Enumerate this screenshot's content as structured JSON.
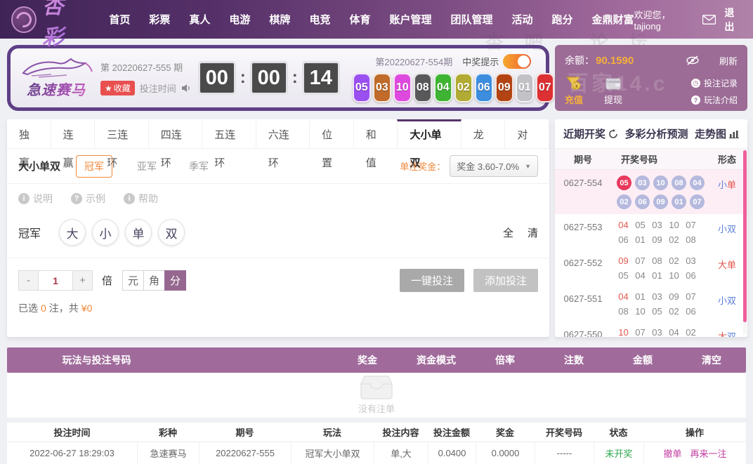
{
  "navbar": {
    "brand": "杏彩",
    "items": [
      "首页",
      "彩票",
      "真人",
      "电游",
      "棋牌",
      "电竞",
      "体育",
      "账户管理",
      "团队管理",
      "活动",
      "跑分",
      "金鼎财富"
    ],
    "welcome": "欢迎您，tajiong",
    "logout": "退出"
  },
  "watermarks": {
    "nav": "杏吧 论坛",
    "wallet": "百家14.c"
  },
  "banner": {
    "game_name": "急速赛马",
    "issue_label": "第 20220627-555 期",
    "favorite_label": "收藏",
    "bet_time_label": "投注时间",
    "countdown": {
      "h": "00",
      "m": "00",
      "s": "14"
    },
    "last_issue_label": "第20220627-554期",
    "win_tip_label": "中奖提示",
    "result_numbers": [
      {
        "num": "05",
        "color": "#9a4ff0"
      },
      {
        "num": "03",
        "color": "#c06b2a"
      },
      {
        "num": "10",
        "color": "#de4ade"
      },
      {
        "num": "08",
        "color": "#58585a"
      },
      {
        "num": "04",
        "color": "#3fb332"
      },
      {
        "num": "02",
        "color": "#b2ab33"
      },
      {
        "num": "06",
        "color": "#3d8ddf"
      },
      {
        "num": "09",
        "color": "#b24413"
      },
      {
        "num": "01",
        "color": "#c2c2c6"
      },
      {
        "num": "07",
        "color": "#dc3032"
      }
    ]
  },
  "wallet": {
    "balance_label": "余额：",
    "balance_value": "90.1590",
    "refresh_label": "刷新",
    "recharge_label": "充值",
    "withdraw_label": "提现",
    "record_label": "投注记录",
    "intro_label": "玩法介绍"
  },
  "tabs": {
    "items": [
      "独赢",
      "连赢",
      "三连环",
      "四连环",
      "五连环",
      "六连环",
      "位置",
      "和值",
      "大小单双",
      "龙虎",
      "对决"
    ],
    "active_index": 8
  },
  "bet": {
    "group_title": "大小单双",
    "positions": [
      "冠军",
      "亚军",
      "季军"
    ],
    "active_position": 0,
    "prize_label": "单注奖金：",
    "prize_value": "奖金 3.60-7.0%",
    "helpers": [
      {
        "icon": "i",
        "label": "说明"
      },
      {
        "icon": "?",
        "label": "示例"
      },
      {
        "icon": "i",
        "label": "帮助"
      }
    ],
    "row_label": "冠军",
    "options": [
      "大",
      "小",
      "单",
      "双"
    ],
    "select_all_label": "全",
    "clear_label": "清",
    "stepper": {
      "minus": "-",
      "value": "1",
      "plus": "+",
      "unit_label": "倍"
    },
    "units": [
      "元",
      "角",
      "分"
    ],
    "active_unit": 2,
    "selected_prefix": "已选",
    "selected_count": "0",
    "selected_infix": "注，共",
    "selected_amount": "¥0",
    "quick_bet_label": "一键投注",
    "add_bet_label": "添加投注"
  },
  "history": {
    "title": "近期开奖",
    "analysis_label": "多彩分析预测",
    "trend_label": "走势图",
    "columns": [
      "期号",
      "开奖号码",
      "形态"
    ],
    "rows": [
      {
        "issue": "0627-554",
        "style": "balls",
        "highlight": true,
        "line1": [
          "05",
          "03",
          "10",
          "08",
          "04"
        ],
        "line2": [
          "02",
          "06",
          "09",
          "01",
          "07"
        ],
        "pattern": [
          {
            "text": "小",
            "color": "#5b7fd9"
          },
          {
            "text": "单",
            "color": "#e2574c"
          }
        ]
      },
      {
        "issue": "0627-553",
        "style": "text",
        "highlight": false,
        "line1": [
          "04",
          "05",
          "03",
          "10",
          "07"
        ],
        "line2": [
          "06",
          "01",
          "09",
          "02",
          "08"
        ],
        "pattern": [
          {
            "text": "小",
            "color": "#5b7fd9"
          },
          {
            "text": "双",
            "color": "#5b7fd9"
          }
        ]
      },
      {
        "issue": "0627-552",
        "style": "text",
        "highlight": false,
        "line1": [
          "09",
          "07",
          "08",
          "02",
          "03"
        ],
        "line2": [
          "05",
          "04",
          "01",
          "10",
          "06"
        ],
        "pattern": [
          {
            "text": "大",
            "color": "#e2574c"
          },
          {
            "text": "单",
            "color": "#e2574c"
          }
        ]
      },
      {
        "issue": "0627-551",
        "style": "text",
        "highlight": false,
        "line1": [
          "04",
          "01",
          "03",
          "09",
          "07"
        ],
        "line2": [
          "08",
          "10",
          "05",
          "02",
          "06"
        ],
        "pattern": [
          {
            "text": "小",
            "color": "#5b7fd9"
          },
          {
            "text": "双",
            "color": "#5b7fd9"
          }
        ]
      },
      {
        "issue": "0627-550",
        "style": "text",
        "highlight": false,
        "line1": [
          "10",
          "07",
          "03",
          "04",
          "02"
        ],
        "line2": [],
        "pattern": [
          {
            "text": "大",
            "color": "#e2574c"
          },
          {
            "text": "双",
            "color": "#5b7fd9"
          }
        ]
      }
    ]
  },
  "cart": {
    "columns": [
      "玩法与投注号码",
      "奖金",
      "资金模式",
      "倍率",
      "注数",
      "金额",
      "清空"
    ],
    "empty_label": "没有注单"
  },
  "orders": {
    "columns": [
      "投注时间",
      "彩种",
      "期号",
      "玩法",
      "投注内容",
      "投注金额",
      "奖金",
      "开奖号码",
      "状态",
      "操作"
    ],
    "rows": [
      {
        "time": "2022-06-27 18:29:03",
        "game": "急速赛马",
        "issue": "20220627-555",
        "play": "冠军大小单双",
        "content": "单,大",
        "amount": "0.0400",
        "prize": "0.0000",
        "result": "-----",
        "status": "未开奖",
        "ops": [
          "撤单",
          "再来一注"
        ]
      }
    ]
  }
}
